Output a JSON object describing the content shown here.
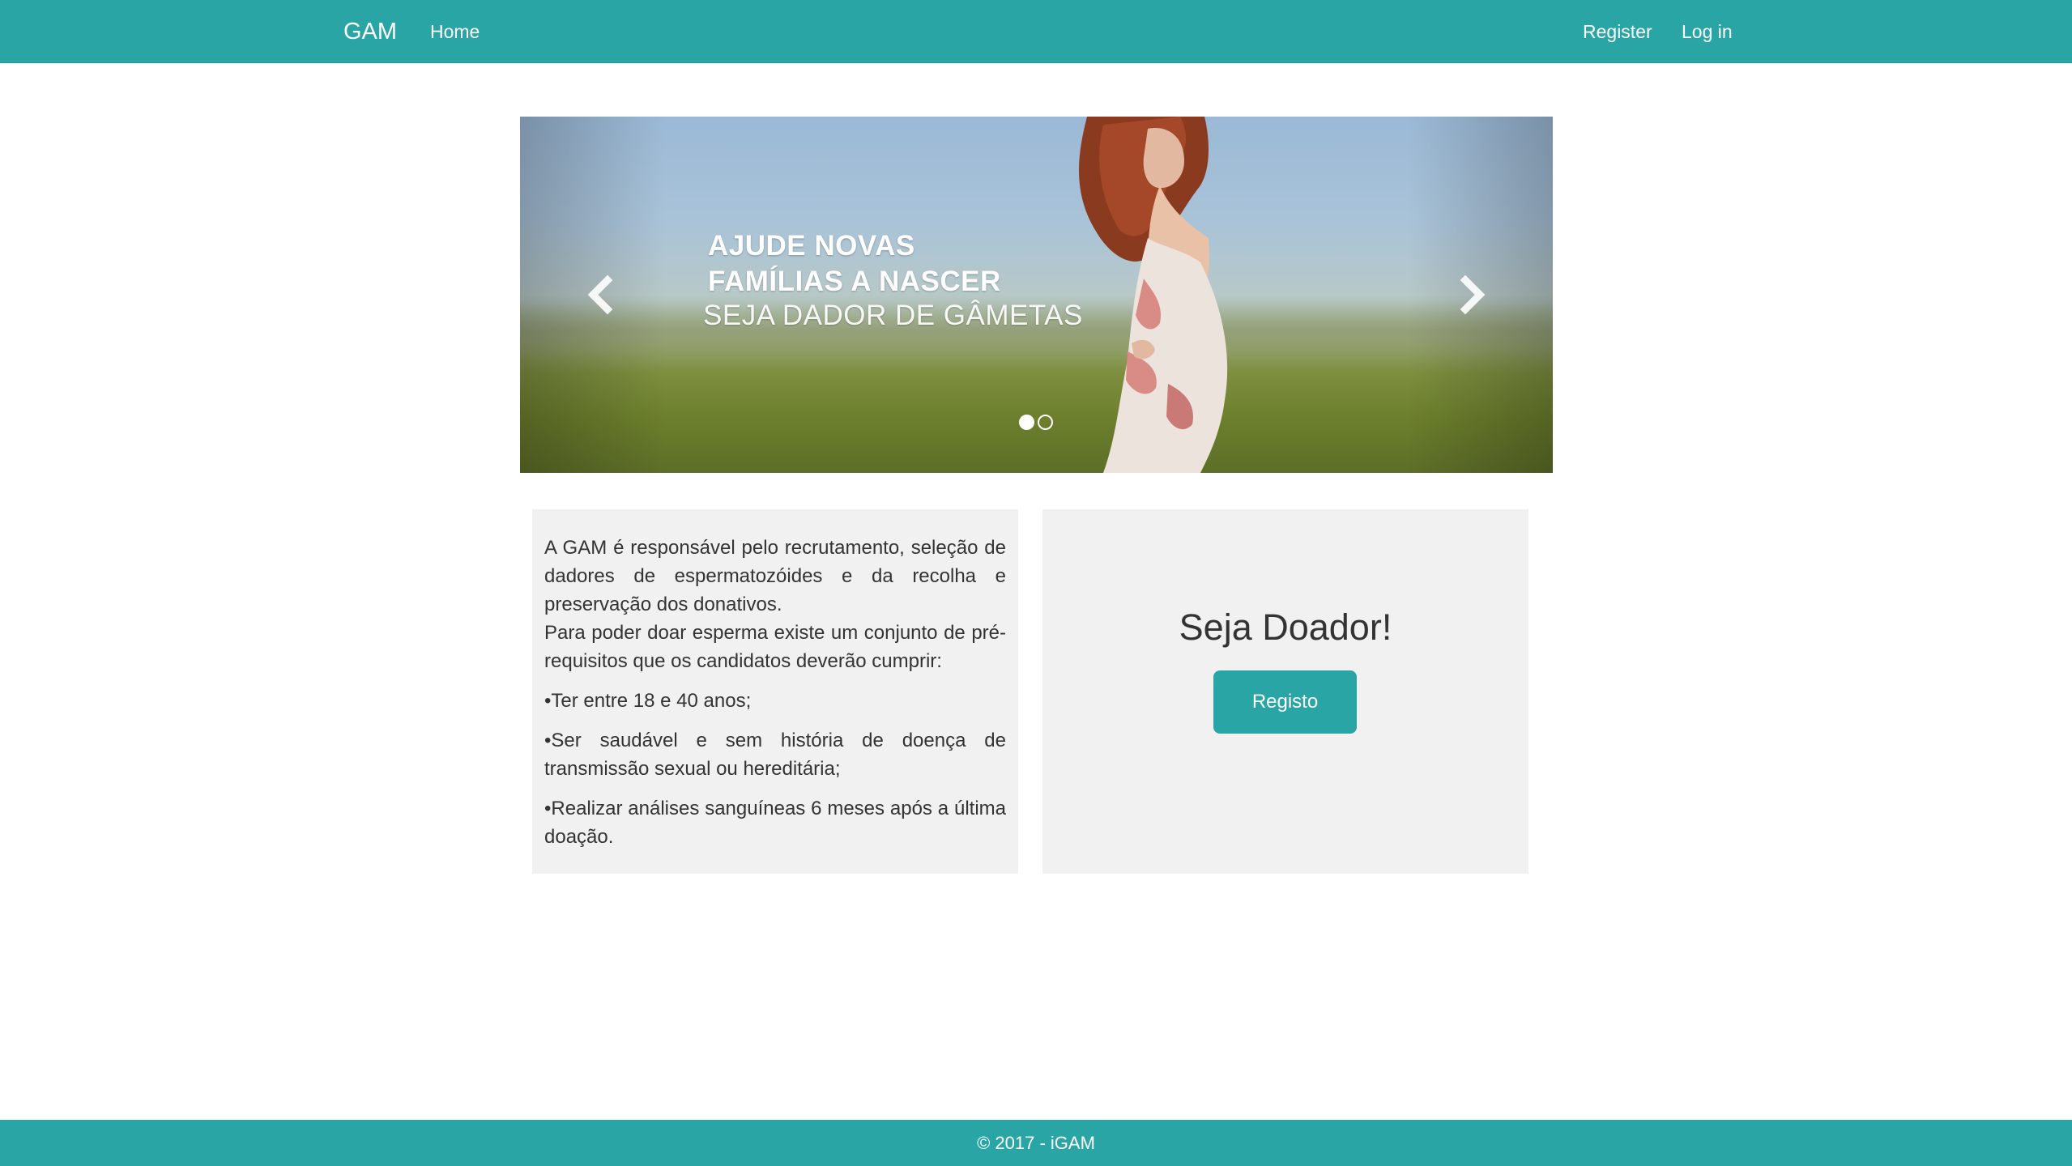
{
  "navbar": {
    "brand": "GAM",
    "home_label": "Home",
    "register_label": "Register",
    "login_label": "Log in"
  },
  "carousel": {
    "slide_line1": "AJUDE NOVAS",
    "slide_line2": "FAMÍLIAS A NASCER",
    "slide_line3": "SEJA DADOR DE GÂMETAS",
    "prev_icon": "chevron-left-icon",
    "next_icon": "chevron-right-icon",
    "slide_count": 2,
    "active_slide": 1
  },
  "info": {
    "intro": "A GAM é responsável pelo recrutamento, seleção de dadores de espermatozóides e da recolha e preservação dos donativos.",
    "requirements_intro": "Para poder doar esperma existe um conjunto de pré-requisitos que os candidatos deverão cumprir:",
    "bullets": [
      "•Ter entre 18 e 40 anos;",
      "•Ser saudável e sem história de doença de transmissão sexual ou hereditária;",
      "•Realizar análises sanguíneas 6 meses após a última doação."
    ]
  },
  "cta": {
    "title": "Seja Doador!",
    "button_label": "Registo"
  },
  "footer": {
    "copyright": "© 2017 - iGAM"
  },
  "colors": {
    "primary": "#2aa5a5",
    "panel": "#f1f1f1",
    "text": "#333333"
  }
}
